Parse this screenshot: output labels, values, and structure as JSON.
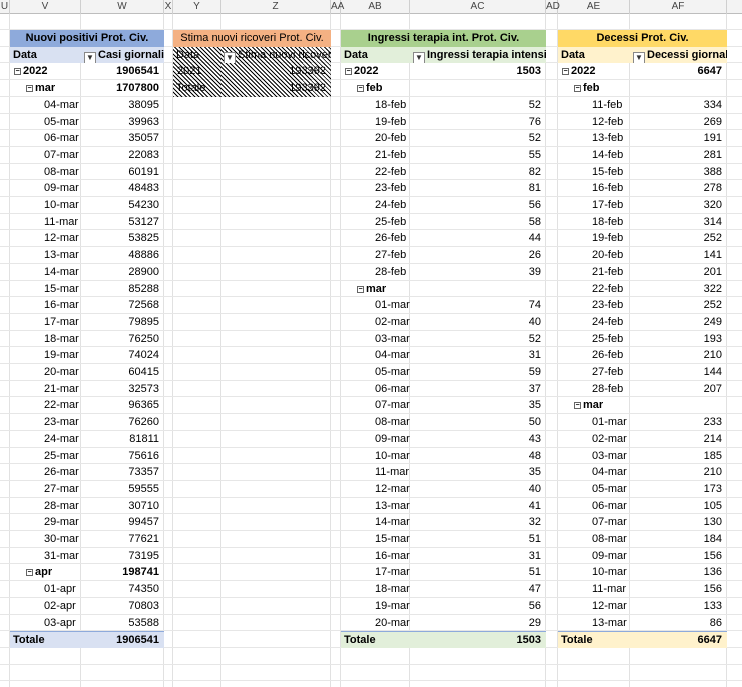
{
  "column_headers": [
    "U",
    "V",
    "W",
    "X",
    "Y",
    "Z",
    "AA",
    "AB",
    "AC",
    "AD",
    "AE",
    "AF"
  ],
  "colors": {
    "blue_title": "#8eaadb",
    "blue_header": "#d9e1f2",
    "orange_title": "#f4b183",
    "green_title": "#a9d08e",
    "green_header": "#e2efda",
    "yellow_title": "#ffd966",
    "yellow_header": "#fff2cc"
  },
  "pivot1": {
    "title": "Nuovi positivi Prot. Civ.",
    "col1": "Data",
    "col2": "Casi giornalieri",
    "year": "2022",
    "year_total": "1906541",
    "month_mar": "mar",
    "month_mar_total": "1707800",
    "rows_mar": [
      {
        "d": "04-mar",
        "v": "38095"
      },
      {
        "d": "05-mar",
        "v": "39963"
      },
      {
        "d": "06-mar",
        "v": "35057"
      },
      {
        "d": "07-mar",
        "v": "22083"
      },
      {
        "d": "08-mar",
        "v": "60191"
      },
      {
        "d": "09-mar",
        "v": "48483"
      },
      {
        "d": "10-mar",
        "v": "54230"
      },
      {
        "d": "11-mar",
        "v": "53127"
      },
      {
        "d": "12-mar",
        "v": "53825"
      },
      {
        "d": "13-mar",
        "v": "48886"
      },
      {
        "d": "14-mar",
        "v": "28900"
      },
      {
        "d": "15-mar",
        "v": "85288"
      },
      {
        "d": "16-mar",
        "v": "72568"
      },
      {
        "d": "17-mar",
        "v": "79895"
      },
      {
        "d": "18-mar",
        "v": "76250"
      },
      {
        "d": "19-mar",
        "v": "74024"
      },
      {
        "d": "20-mar",
        "v": "60415"
      },
      {
        "d": "21-mar",
        "v": "32573"
      },
      {
        "d": "22-mar",
        "v": "96365"
      },
      {
        "d": "23-mar",
        "v": "76260"
      },
      {
        "d": "24-mar",
        "v": "81811"
      },
      {
        "d": "25-mar",
        "v": "75616"
      },
      {
        "d": "26-mar",
        "v": "73357"
      },
      {
        "d": "27-mar",
        "v": "59555"
      },
      {
        "d": "28-mar",
        "v": "30710"
      },
      {
        "d": "29-mar",
        "v": "99457"
      },
      {
        "d": "30-mar",
        "v": "77621"
      },
      {
        "d": "31-mar",
        "v": "73195"
      }
    ],
    "month_apr": "apr",
    "month_apr_total": "198741",
    "rows_apr": [
      {
        "d": "01-apr",
        "v": "74350"
      },
      {
        "d": "02-apr",
        "v": "70803"
      },
      {
        "d": "03-apr",
        "v": "53588"
      }
    ],
    "total_label": "Totale",
    "total": "1906541"
  },
  "pivot2": {
    "title": "Stima nuovi ricoveri Prot. Civ.",
    "col1": "Data",
    "col2": "Stima nuovi ricoveri",
    "year": "2021",
    "year_total": "193392",
    "total_label": "Totale",
    "total": "193392"
  },
  "pivot3": {
    "title": "Ingressi terapia int. Prot. Civ.",
    "col1": "Data",
    "col2": "Ingressi terapia intensiva",
    "year": "2022",
    "year_total": "1503",
    "month_feb": "feb",
    "rows_feb": [
      {
        "d": "18-feb",
        "v": "52"
      },
      {
        "d": "19-feb",
        "v": "76"
      },
      {
        "d": "20-feb",
        "v": "52"
      },
      {
        "d": "21-feb",
        "v": "55"
      },
      {
        "d": "22-feb",
        "v": "82"
      },
      {
        "d": "23-feb",
        "v": "81"
      },
      {
        "d": "24-feb",
        "v": "56"
      },
      {
        "d": "25-feb",
        "v": "58"
      },
      {
        "d": "26-feb",
        "v": "44"
      },
      {
        "d": "27-feb",
        "v": "26"
      },
      {
        "d": "28-feb",
        "v": "39"
      }
    ],
    "month_mar": "mar",
    "rows_mar": [
      {
        "d": "01-mar",
        "v": "74"
      },
      {
        "d": "02-mar",
        "v": "40"
      },
      {
        "d": "03-mar",
        "v": "52"
      },
      {
        "d": "04-mar",
        "v": "31"
      },
      {
        "d": "05-mar",
        "v": "59"
      },
      {
        "d": "06-mar",
        "v": "37"
      },
      {
        "d": "07-mar",
        "v": "35"
      },
      {
        "d": "08-mar",
        "v": "50"
      },
      {
        "d": "09-mar",
        "v": "43"
      },
      {
        "d": "10-mar",
        "v": "48"
      },
      {
        "d": "11-mar",
        "v": "35"
      },
      {
        "d": "12-mar",
        "v": "40"
      },
      {
        "d": "13-mar",
        "v": "41"
      },
      {
        "d": "14-mar",
        "v": "32"
      },
      {
        "d": "15-mar",
        "v": "51"
      },
      {
        "d": "16-mar",
        "v": "31"
      },
      {
        "d": "17-mar",
        "v": "51"
      },
      {
        "d": "18-mar",
        "v": "47"
      },
      {
        "d": "19-mar",
        "v": "56"
      },
      {
        "d": "20-mar",
        "v": "29"
      }
    ],
    "total_label": "Totale",
    "total": "1503"
  },
  "pivot4": {
    "title": "Decessi Prot. Civ.",
    "col1": "Data",
    "col2": "Decessi giornalieri",
    "year": "2022",
    "year_total": "6647",
    "month_feb": "feb",
    "rows_feb": [
      {
        "d": "11-feb",
        "v": "334"
      },
      {
        "d": "12-feb",
        "v": "269"
      },
      {
        "d": "13-feb",
        "v": "191"
      },
      {
        "d": "14-feb",
        "v": "281"
      },
      {
        "d": "15-feb",
        "v": "388"
      },
      {
        "d": "16-feb",
        "v": "278"
      },
      {
        "d": "17-feb",
        "v": "320"
      },
      {
        "d": "18-feb",
        "v": "314"
      },
      {
        "d": "19-feb",
        "v": "252"
      },
      {
        "d": "20-feb",
        "v": "141"
      },
      {
        "d": "21-feb",
        "v": "201"
      },
      {
        "d": "22-feb",
        "v": "322"
      },
      {
        "d": "23-feb",
        "v": "252"
      },
      {
        "d": "24-feb",
        "v": "249"
      },
      {
        "d": "25-feb",
        "v": "193"
      },
      {
        "d": "26-feb",
        "v": "210"
      },
      {
        "d": "27-feb",
        "v": "144"
      },
      {
        "d": "28-feb",
        "v": "207"
      }
    ],
    "month_mar": "mar",
    "rows_mar": [
      {
        "d": "01-mar",
        "v": "233"
      },
      {
        "d": "02-mar",
        "v": "214"
      },
      {
        "d": "03-mar",
        "v": "185"
      },
      {
        "d": "04-mar",
        "v": "210"
      },
      {
        "d": "05-mar",
        "v": "173"
      },
      {
        "d": "06-mar",
        "v": "105"
      },
      {
        "d": "07-mar",
        "v": "130"
      },
      {
        "d": "08-mar",
        "v": "184"
      },
      {
        "d": "09-mar",
        "v": "156"
      },
      {
        "d": "10-mar",
        "v": "136"
      },
      {
        "d": "11-mar",
        "v": "156"
      },
      {
        "d": "12-mar",
        "v": "133"
      },
      {
        "d": "13-mar",
        "v": "86"
      }
    ],
    "total_label": "Totale",
    "total": "6647"
  }
}
